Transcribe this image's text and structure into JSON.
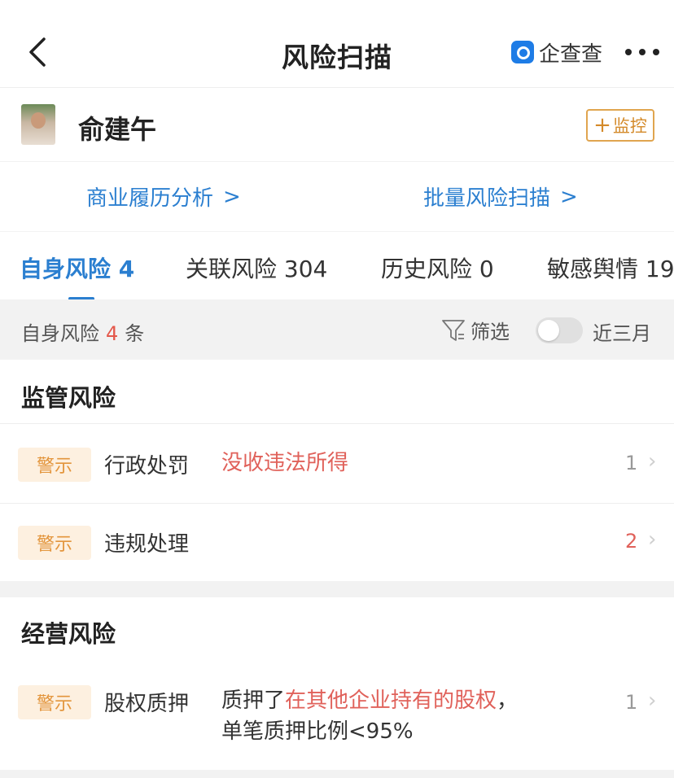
{
  "header": {
    "title": "风险扫描",
    "brand": "企查查"
  },
  "person": {
    "name": "俞建午",
    "monitor_label": "监控",
    "monitor_plus": "+"
  },
  "links": [
    {
      "label": "商业履历分析",
      "chevron": ">"
    },
    {
      "label": "批量风险扫描",
      "chevron": ">"
    }
  ],
  "tabs": [
    {
      "label": "自身风险 4",
      "active": true
    },
    {
      "label": "关联风险 304",
      "active": false
    },
    {
      "label": "历史风险 0",
      "active": false
    },
    {
      "label": "敏感舆情 19",
      "active": false
    }
  ],
  "filterbar": {
    "prefix": "自身风险",
    "count": "4",
    "suffix": "条",
    "filter_label": "筛选",
    "toggle_label": "近三月",
    "toggle_on": false
  },
  "sections": [
    {
      "title": "监管风险",
      "rows": [
        {
          "badge": "警示",
          "type": "行政处罚",
          "desc_red": "没收违法所得",
          "count": "1"
        },
        {
          "badge": "警示",
          "type": "违规处理",
          "count": "2"
        }
      ]
    },
    {
      "title": "经营风险",
      "rows": [
        {
          "badge": "警示",
          "type": "股权质押",
          "desc_prefix": "质押了",
          "desc_red": "在其他企业持有的股权",
          "desc_suffix": "，",
          "desc_line2": "单笔质押比例<95%",
          "count": "1"
        }
      ]
    }
  ],
  "row_chevron": "›",
  "colors": {
    "accent": "#2b7fd0",
    "warning": "#e3953c",
    "danger": "#e0615a",
    "monitor_border": "#e0a54f"
  }
}
